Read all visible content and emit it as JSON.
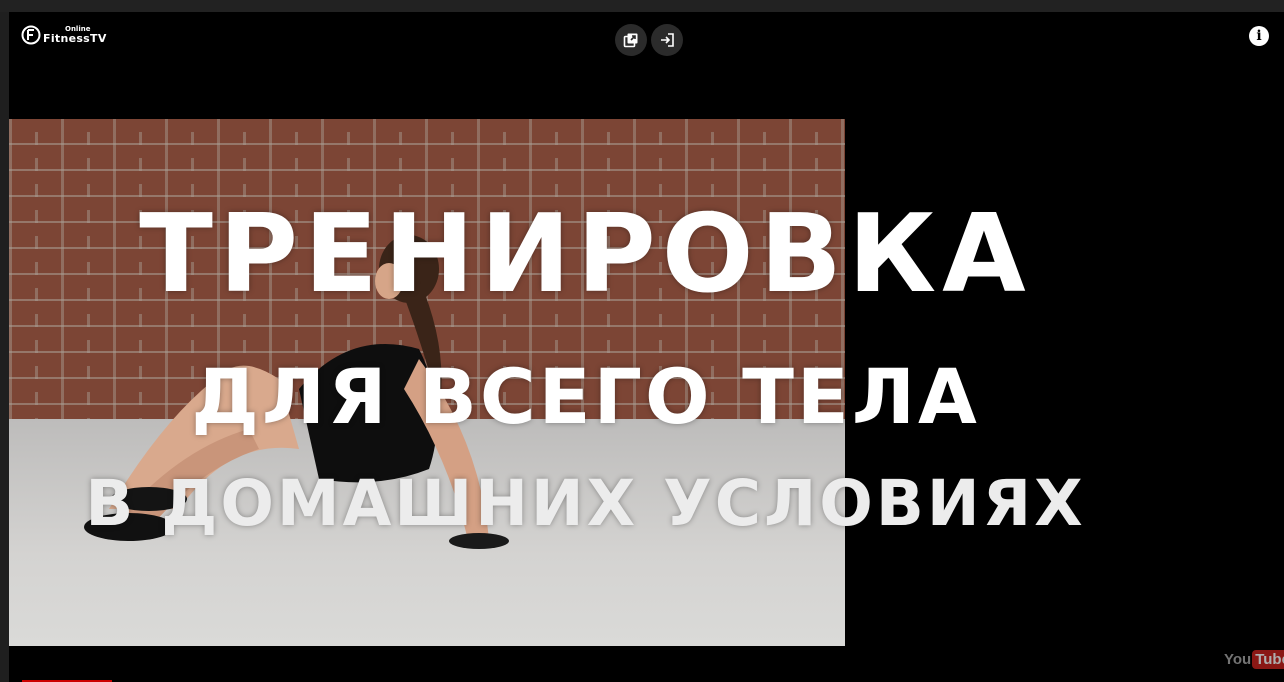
{
  "channel": {
    "logo_top": "Online",
    "logo_name": "FitnessTV"
  },
  "video": {
    "title_line1": "ТРЕНИРОВКА",
    "title_line2": "ДЛЯ ВСЕГО ТЕЛА",
    "title_line3": "В ДОМАШНИХ УСЛОВИЯХ"
  },
  "controls": {
    "info_label": "i",
    "popout_icon": "popout-icon",
    "enter_icon": "enter-icon"
  },
  "watermark": {
    "you": "You",
    "tube": "Tube"
  },
  "colors": {
    "background": "#000000",
    "youtube_red": "#b8211d",
    "title_text": "#ffffff"
  }
}
